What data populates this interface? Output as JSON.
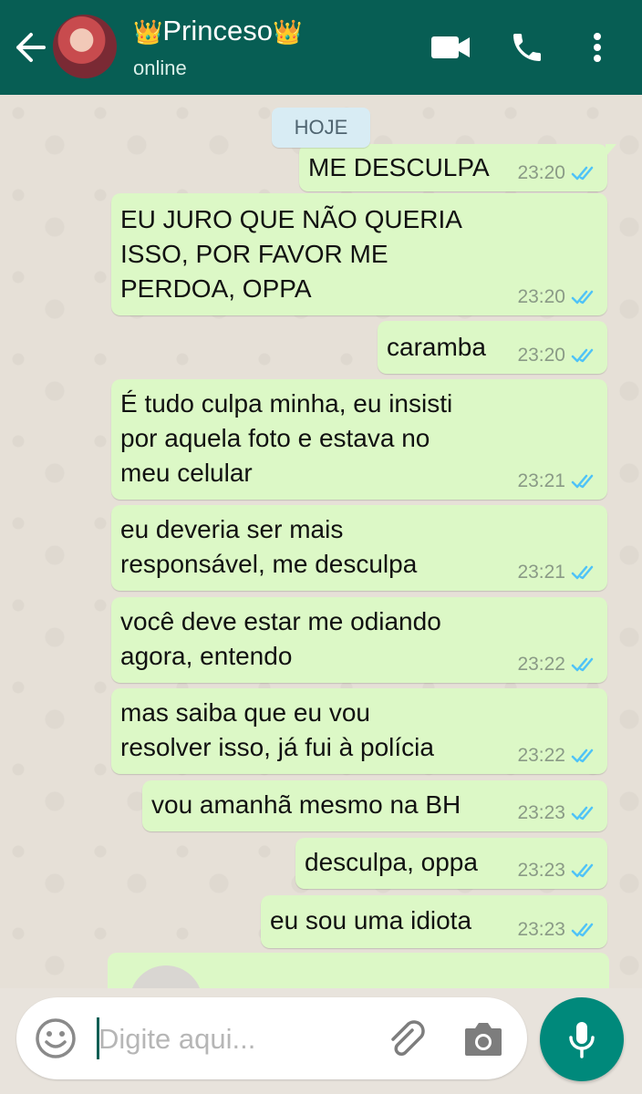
{
  "header": {
    "contact_name": "Princeso",
    "crown_left": "👑",
    "crown_right": "👑",
    "status": "online",
    "icons": [
      "back-arrow-icon",
      "video-call-icon",
      "phone-icon",
      "more-vert-icon"
    ]
  },
  "chat": {
    "date_label": "HOJE",
    "messages": [
      {
        "text": "ME DESCULPA",
        "time": "23:20"
      },
      {
        "text": "EU JURO QUE NÃO QUERIA\nISSO, POR FAVOR ME\nPERDOA, OPPA",
        "time": "23:20"
      },
      {
        "text": "caramba",
        "time": "23:20"
      },
      {
        "text": "É tudo culpa minha, eu insisti\npor aquela foto e estava no\nmeu celular",
        "time": "23:21"
      },
      {
        "text": "eu deveria ser mais\nresponsável, me desculpa",
        "time": "23:21"
      },
      {
        "text": "você deve estar me odiando\nagora, entendo",
        "time": "23:22"
      },
      {
        "text": "mas saiba que eu vou\nresolver isso, já fui à polícia",
        "time": "23:22"
      },
      {
        "text": "vou amanhã mesmo na BH",
        "time": "23:23"
      },
      {
        "text": "desculpa, oppa",
        "time": "23:23"
      },
      {
        "text": "eu sou uma idiota",
        "time": "23:23"
      }
    ]
  },
  "composer": {
    "placeholder": "Digite aqui...",
    "icons": [
      "emoji-icon",
      "attach-icon",
      "camera-icon",
      "mic-icon"
    ]
  },
  "colors": {
    "header": "#075e54",
    "outgoing_bubble": "#dcf8c6",
    "read_ticks": "#4fc3f7",
    "mic_button": "#00897b"
  }
}
